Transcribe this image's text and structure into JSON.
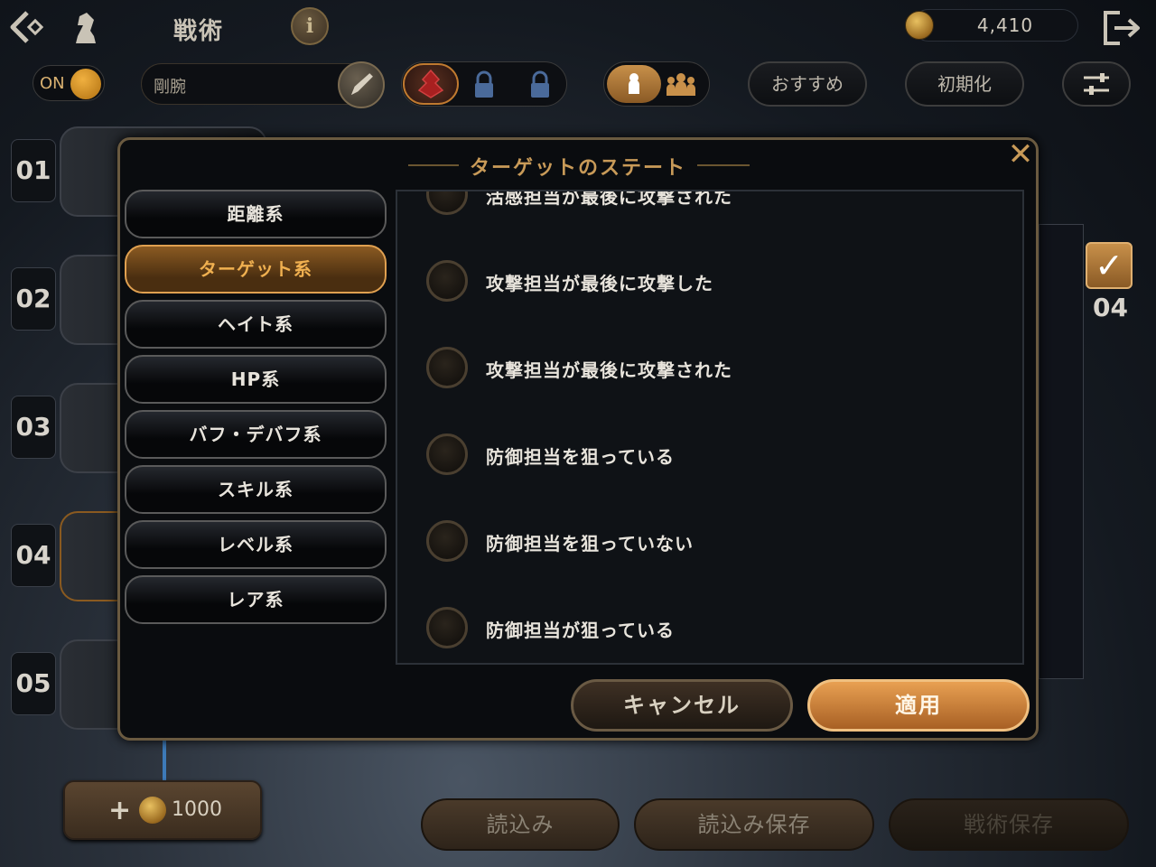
{
  "header": {
    "title": "戦術",
    "info_label": "i",
    "currency_value": "4,410"
  },
  "toolbar": {
    "toggle_label": "ON",
    "tactic_name": "剛腕",
    "recommend_label": "おすすめ",
    "reset_label": "初期化"
  },
  "slots": [
    {
      "number": "01"
    },
    {
      "number": "02"
    },
    {
      "number": "03"
    },
    {
      "number": "04"
    },
    {
      "number": "05"
    }
  ],
  "side": {
    "number": "04"
  },
  "footer": {
    "add_cost": "1000",
    "load_label": "読込み",
    "load_save_label": "読込み保存",
    "tactic_save_label": "戦術保存"
  },
  "modal": {
    "title": "ターゲットのステート",
    "categories": [
      {
        "label": "距離系"
      },
      {
        "label": "ターゲット系",
        "active": true
      },
      {
        "label": "ヘイト系"
      },
      {
        "label": "HP系"
      },
      {
        "label": "バフ・デバフ系"
      },
      {
        "label": "スキル系"
      },
      {
        "label": "レベル系"
      },
      {
        "label": "レア系"
      }
    ],
    "options": [
      {
        "label": "活感担当が最後に攻撃された"
      },
      {
        "label": "攻撃担当が最後に攻撃した"
      },
      {
        "label": "攻撃担当が最後に攻撃された"
      },
      {
        "label": "防御担当を狙っている"
      },
      {
        "label": "防御担当を狙っていない"
      },
      {
        "label": "防御担当が狙っている"
      }
    ],
    "cancel_label": "キャンセル",
    "apply_label": "適用"
  },
  "colors": {
    "accent": "#e8a052",
    "gold_text": "#c89a58",
    "active_text": "#f0b050"
  }
}
